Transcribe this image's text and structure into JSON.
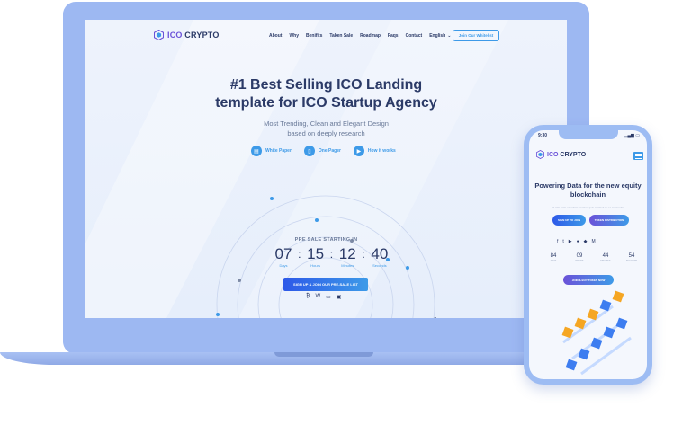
{
  "site": {
    "logo": {
      "brand_ico": "ICO",
      "brand_rest": " CRYPTO"
    },
    "nav": {
      "items": [
        "About",
        "Why",
        "Benifits",
        "Taken Sale",
        "Roadmap",
        "Faqs",
        "Contact"
      ],
      "language": "English",
      "whitelist_button": "Join Our Whitelist"
    },
    "hero": {
      "title_line1": "#1 Best Selling ICO Landing",
      "title_line2": "template for ICO Startup Agency",
      "subtitle_line1": "Most Trending, Clean and Elegant Design",
      "subtitle_line2": "based on deeply research",
      "links": [
        {
          "label": "White Paper",
          "icon": "document-icon"
        },
        {
          "label": "One Pager",
          "icon": "page-icon"
        },
        {
          "label": "How it works",
          "icon": "play-icon"
        }
      ]
    },
    "countdown": {
      "label": "PRE SALE STARTING IN",
      "days": "07",
      "hours": "15",
      "minutes": "12",
      "seconds": "40",
      "days_label": "Days",
      "hours_label": "Hours",
      "minutes_label": "Minutes",
      "seconds_label": "Seconds"
    },
    "cta_button": "SIGN UP & JOIN OUR PRE-SALE LIST",
    "payment_icons": [
      "bitcoin-icon",
      "wallet-icon",
      "card-icon",
      "card-alt-icon"
    ]
  },
  "phone": {
    "status_time": "9:30",
    "logo": {
      "brand_ico": "ICO",
      "brand_rest": " CRYPTO"
    },
    "title_line1": "Powering Data for the new equity",
    "title_line2": "blockchain",
    "description": "Ut wisi enim ad minim veniam, quis nostrud ex ea commodo.",
    "buttons": [
      "SIGN UP TO JOIN",
      "TOKEN DISTRIBUTION"
    ],
    "social_icons": [
      "facebook-icon",
      "twitter-icon",
      "youtube-icon",
      "github-icon",
      "bitbucket-icon",
      "medium-icon"
    ],
    "countdown": [
      {
        "num": "84",
        "label": "DAYS"
      },
      {
        "num": "09",
        "label": "HOURS"
      },
      {
        "num": "44",
        "label": "MINUTES"
      },
      {
        "num": "54",
        "label": "SECONDS"
      }
    ],
    "cta_button": "JOIN & BUY TOKEN NOW"
  },
  "colors": {
    "device_blue": "#9db8f2",
    "brand_purple": "#6b52d8",
    "accent_blue": "#3d9ae8",
    "text_dark": "#2b3a67",
    "block_orange": "#f5a623",
    "block_blue": "#3d7df0"
  }
}
